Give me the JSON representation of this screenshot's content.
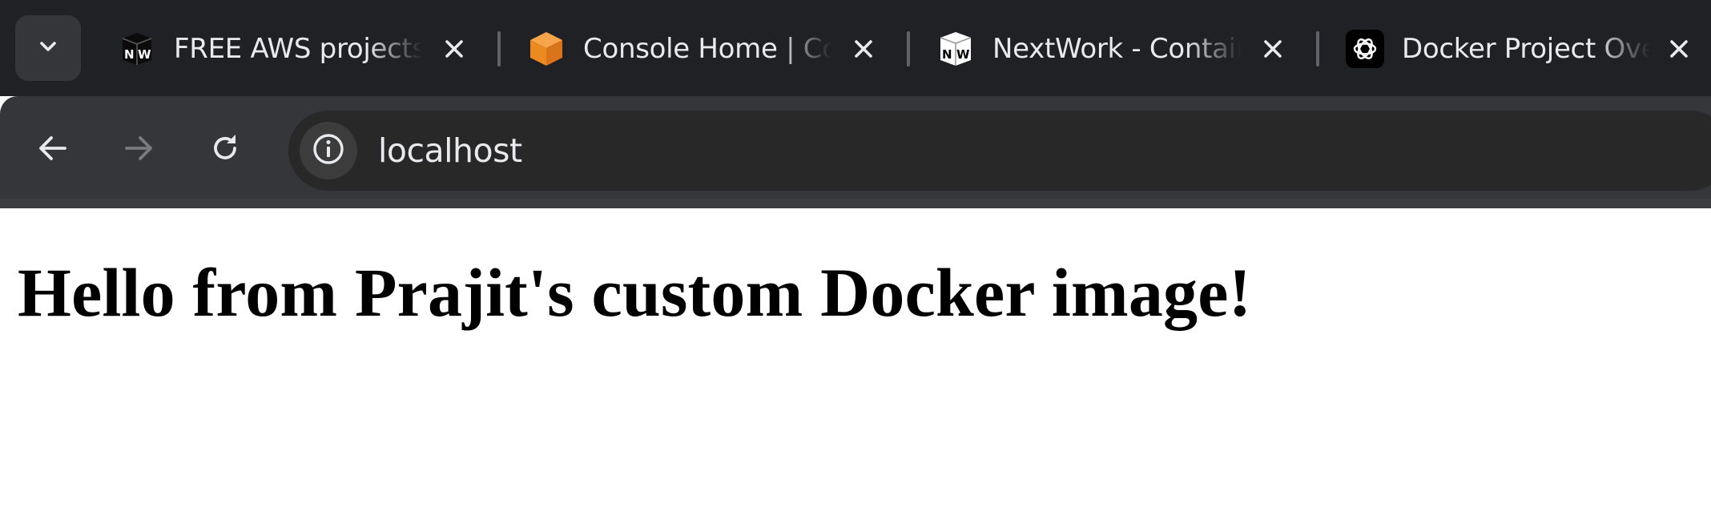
{
  "browser": {
    "tabs": [
      {
        "title": "FREE AWS projects",
        "favicon": "nextwork-nw-icon"
      },
      {
        "title": "Console Home | Console Home",
        "favicon": "aws-cube-icon"
      },
      {
        "title": "NextWork - Containers",
        "favicon": "nextwork-nw-icon"
      },
      {
        "title": "Docker Project Overview",
        "favicon": "chatgpt-icon"
      }
    ],
    "address_bar": {
      "url": "localhost"
    }
  },
  "page": {
    "heading": "Hello from Prajit's custom Docker image!"
  },
  "colors": {
    "tabstrip_bg": "#202124",
    "toolbar_bg": "#35363a",
    "omnibox_bg": "#282828",
    "text_light": "#e8eaed",
    "aws_orange": "#f29130"
  }
}
